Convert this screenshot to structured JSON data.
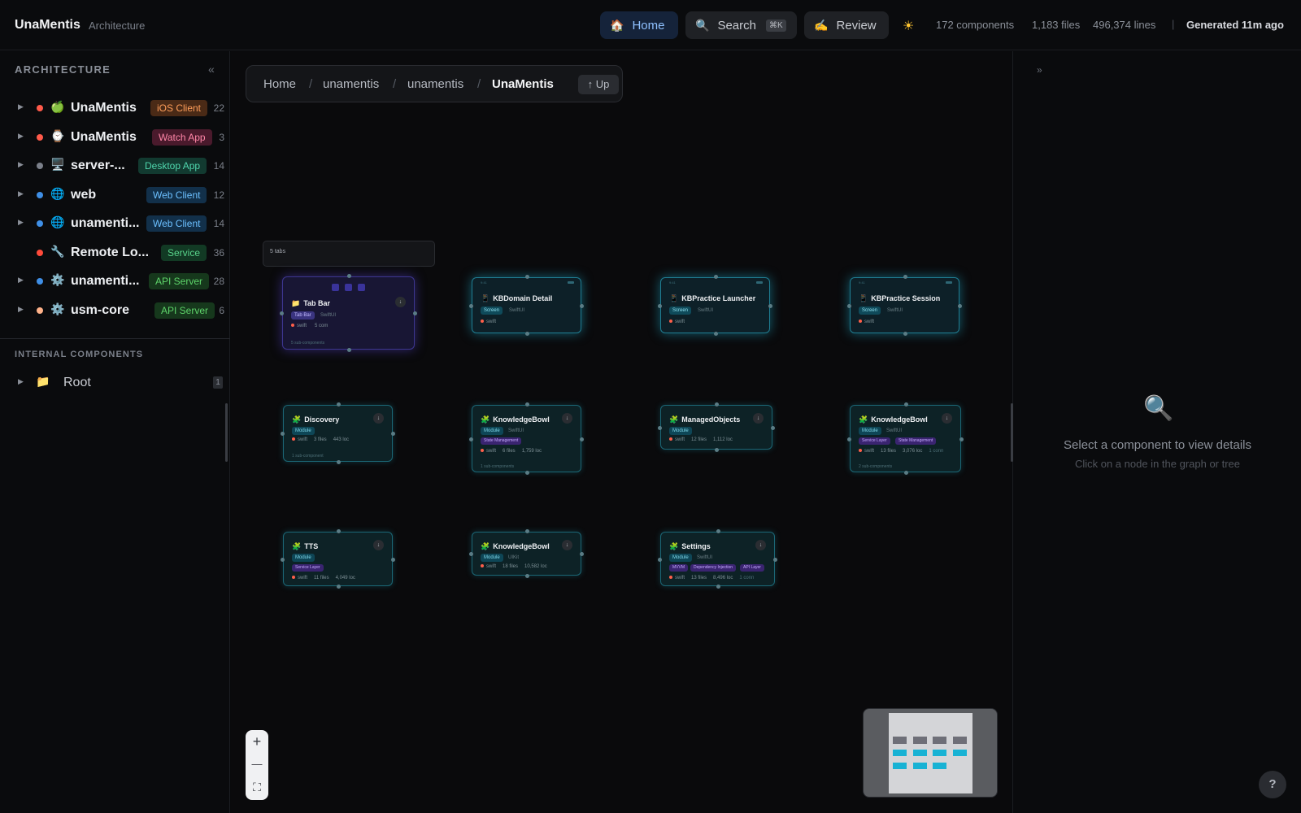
{
  "header": {
    "brand": "UnaMentis",
    "brand_sub": "Architecture",
    "nav": {
      "home": {
        "label": "Home",
        "icon": "home-icon"
      },
      "search": {
        "label": "Search",
        "shortcut": "⌘K",
        "icon": "search-icon"
      },
      "review": {
        "label": "Review",
        "icon": "review-icon"
      }
    },
    "theme_icon": "sun-icon",
    "stats": {
      "components": "172 components",
      "files": "1,183 files",
      "lines": "496,374 lines",
      "separator": "|",
      "generated": "Generated 11m ago"
    }
  },
  "sidebar": {
    "heading": "ARCHITECTURE",
    "collapse_glyph": "«",
    "items": [
      {
        "name": "UnaMentis",
        "badge": "iOS Client",
        "count": "22",
        "dot": "#ff5a4a",
        "icon": "apple-icon",
        "glyph": "🍏"
      },
      {
        "name": "UnaMentis",
        "badge": "Watch App",
        "count": "3",
        "dot": "#ff5a4a",
        "icon": "watch-icon",
        "glyph": "⌚"
      },
      {
        "name": "server-...",
        "badge": "Desktop App",
        "count": "14",
        "dot": "#7b808a",
        "icon": "desktop-icon",
        "glyph": "🖥️"
      },
      {
        "name": "web",
        "badge": "Web Client",
        "count": "12",
        "dot": "#3f8fe6",
        "icon": "globe-icon",
        "glyph": "🌐"
      },
      {
        "name": "unamenti...",
        "badge": "Web Client",
        "count": "14",
        "dot": "#3f8fe6",
        "icon": "globe-icon",
        "glyph": "🌐"
      },
      {
        "name": "Remote Lo...",
        "badge": "Service",
        "count": "36",
        "dot": "#ff4a3a",
        "icon": "wrench-icon",
        "glyph": "🔧"
      },
      {
        "name": "unamenti...",
        "badge": "API Server",
        "count": "28",
        "dot": "#3f8fe6",
        "icon": "gear-icon",
        "glyph": "⚙️"
      },
      {
        "name": "usm-core",
        "badge": "API Server",
        "count": "6",
        "dot": "#ffb28a",
        "icon": "gear-icon",
        "glyph": "⚙️"
      }
    ],
    "internal_heading": "INTERNAL COMPONENTS",
    "root": {
      "name": "Root",
      "count": "1",
      "icon": "folder-icon",
      "glyph": "📁"
    }
  },
  "canvas": {
    "breadcrumb": [
      "Home",
      "unamentis",
      "unamentis",
      "UnaMentis"
    ],
    "breadcrumb_sep": "/",
    "up_label": "↑ Up",
    "tabs_tip": "5 tabs",
    "nodes": {
      "tabbar": {
        "title": "Tab Bar",
        "tag": "Tab Bar",
        "sub": "SwiftUI",
        "meta": "swift",
        "meta2": "5 com",
        "subcomp": "5 sub-components"
      },
      "kbdomain": {
        "title": "KBDomain Detail",
        "tag": "Screen",
        "sub": "SwiftUI",
        "meta": "swift",
        "time": "9:41"
      },
      "kbpl": {
        "title": "KBPractice Launcher",
        "tag": "Screen",
        "sub": "SwiftUI",
        "meta": "swift",
        "time": "9:41"
      },
      "kbps": {
        "title": "KBPractice Session",
        "tag": "Screen",
        "sub": "SwiftUI",
        "meta": "swift",
        "time": "9:41"
      },
      "discovery": {
        "title": "Discovery",
        "tag": "Module",
        "meta": "swift",
        "files": "3 files",
        "loc": "443 loc",
        "subcomp": "1 sub-component"
      },
      "kb1": {
        "title": "KnowledgeBowl",
        "tag": "Module",
        "sub": "SwiftUI",
        "chip1": "State Management",
        "meta": "swift",
        "files": "6 files",
        "loc": "1,759 loc",
        "subcomp": "1 sub-components"
      },
      "managed": {
        "title": "ManagedObjects",
        "tag": "Module",
        "meta": "swift",
        "files": "12 files",
        "loc": "1,112 loc"
      },
      "kb2": {
        "title": "KnowledgeBowl",
        "tag": "Module",
        "sub": "SwiftUI",
        "chip1": "Service Layer",
        "chip2": "State Management",
        "meta": "swift",
        "files": "13 files",
        "loc": "3,076 loc",
        "conn": "1 conn",
        "subcomp": "2 sub-components"
      },
      "tts": {
        "title": "TTS",
        "tag": "Module",
        "chip1": "Service Layer",
        "meta": "swift",
        "files": "11 files",
        "loc": "4,049 loc"
      },
      "kb3": {
        "title": "KnowledgeBowl",
        "tag": "Module",
        "sub": "UIKit",
        "meta": "swift",
        "files": "18 files",
        "loc": "10,582 loc"
      },
      "settings": {
        "title": "Settings",
        "tag": "Module",
        "sub": "SwiftUI",
        "chip1": "MVVM",
        "chip2": "Dependency Injection",
        "chip3": "API Layer",
        "meta": "swift",
        "files": "13 files",
        "loc": "8,496 loc",
        "conn": "1 conn"
      }
    },
    "download_glyph": "↓",
    "zoom": {
      "in": "+",
      "out": "—",
      "fit": "⛶"
    }
  },
  "right_panel": {
    "expand_glyph": "»",
    "empty_title": "Select a component to view details",
    "empty_sub": "Click on a node in the graph or tree",
    "icon": "magnifier-icon"
  },
  "help_label": "?",
  "colors": {
    "accent": "#8fc1ff",
    "screen_border": "#1f7d92",
    "tabbar_border": "#3d3690",
    "module_border": "#1b6675"
  }
}
